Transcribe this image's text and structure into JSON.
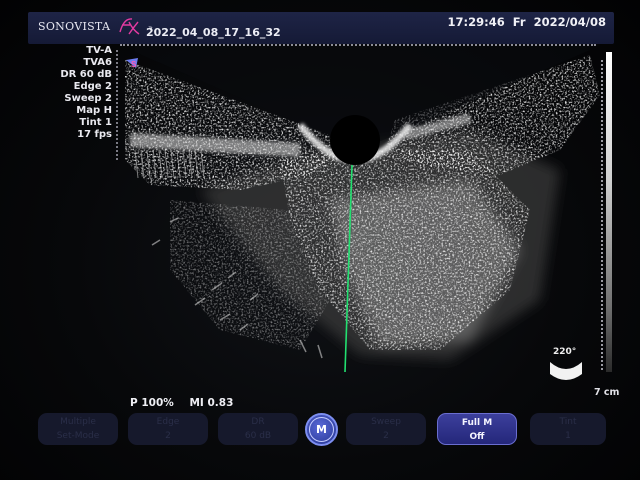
{
  "header": {
    "brand": "SONOVISTA",
    "brand_mark": "fx-script-logo",
    "separator": "»",
    "study_id": "2022_04_08_17_16_32",
    "time": "17:29:46",
    "day": "Fr",
    "date": "2022/04/08"
  },
  "params": [
    "TV-A",
    "TVA6",
    "DR 60 dB",
    "Edge 2",
    "Sweep 2",
    "Map H",
    "Tint 1",
    "17 fps"
  ],
  "orientation_marker": "S",
  "probe": {
    "angle": "220°",
    "icon": "probe-arc-icon"
  },
  "scale": {
    "depth": "7 cm"
  },
  "indicators": {
    "power": "P 100%",
    "mi": "MI 0.83"
  },
  "softkeys": [
    {
      "l1": "Multiple",
      "l2": "Set-Mode"
    },
    {
      "l1": "Edge",
      "l2": "2"
    },
    {
      "l1": "DR",
      "l2": "60 dB"
    },
    {
      "l1": "Sweep",
      "l2": "2"
    },
    {
      "l1": "Full M",
      "l2": "Off"
    },
    {
      "l1": "Tint",
      "l2": "1"
    }
  ],
  "mode_button": "M",
  "colors": {
    "header": "#1b2040",
    "accent": "#3c3f9c",
    "m_line": "#20e070",
    "logo_pink": "#e23aa0"
  }
}
